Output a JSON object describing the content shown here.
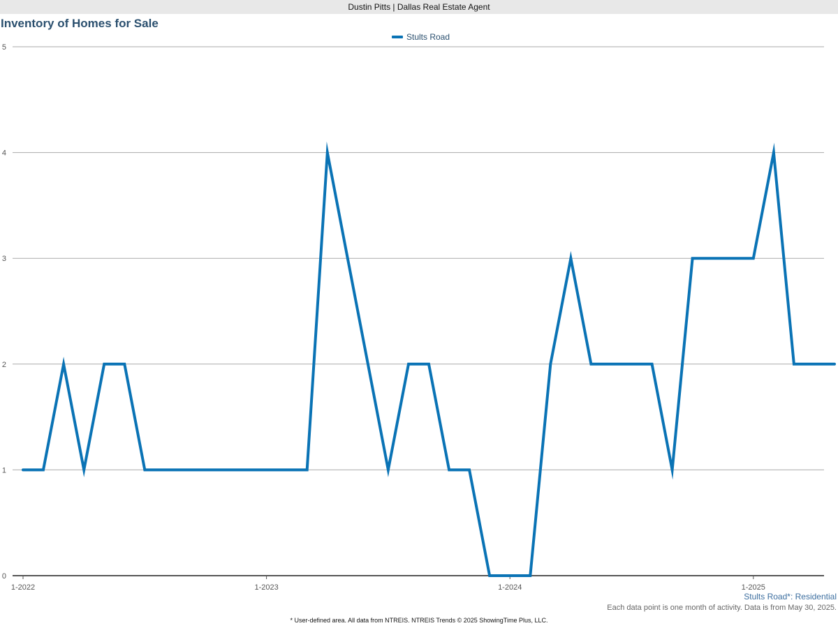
{
  "header": {
    "agent": "Dustin Pitts | Dallas Real Estate Agent"
  },
  "colors": {
    "series": "#0a73b5",
    "grid": "#aaaaaa",
    "axis": "#555555",
    "title": "#2a4f6e"
  },
  "chart_data": {
    "type": "line",
    "title": "Inventory of Homes for Sale",
    "xlabel": "",
    "ylabel": "",
    "ylim": [
      0,
      5
    ],
    "yticks": [
      "0",
      "1",
      "2",
      "3",
      "4",
      "5"
    ],
    "xticks": [
      "1-2022",
      "1-2023",
      "1-2024",
      "1-2025"
    ],
    "grid": true,
    "legend_position": "top-center",
    "x": [
      "1-2022",
      "2-2022",
      "3-2022",
      "4-2022",
      "5-2022",
      "6-2022",
      "7-2022",
      "8-2022",
      "9-2022",
      "10-2022",
      "11-2022",
      "12-2022",
      "1-2023",
      "2-2023",
      "3-2023",
      "4-2023",
      "5-2023",
      "6-2023",
      "7-2023",
      "8-2023",
      "9-2023",
      "10-2023",
      "11-2023",
      "12-2023",
      "1-2024",
      "2-2024",
      "3-2024",
      "4-2024",
      "5-2024",
      "6-2024",
      "7-2024",
      "8-2024",
      "9-2024",
      "10-2024",
      "11-2024",
      "12-2024",
      "1-2025",
      "2-2025",
      "3-2025",
      "4-2025",
      "5-2025"
    ],
    "series": [
      {
        "name": "Stults Road",
        "values": [
          1,
          1,
          2,
          1,
          2,
          2,
          1,
          1,
          1,
          1,
          1,
          1,
          1,
          1,
          1,
          4,
          3,
          2,
          1,
          2,
          2,
          1,
          1,
          0,
          0,
          0,
          2,
          3,
          2,
          2,
          2,
          2,
          1,
          3,
          3,
          3,
          3,
          4,
          2,
          2,
          2
        ]
      }
    ]
  },
  "footer": {
    "area_label": "Stults Road*: Residential",
    "note": "Each data point is one month of activity. Data is from May 30, 2025.",
    "footnote": "* User-defined area. All data from NTREIS. NTREIS Trends © 2025 ShowingTime Plus, LLC."
  }
}
